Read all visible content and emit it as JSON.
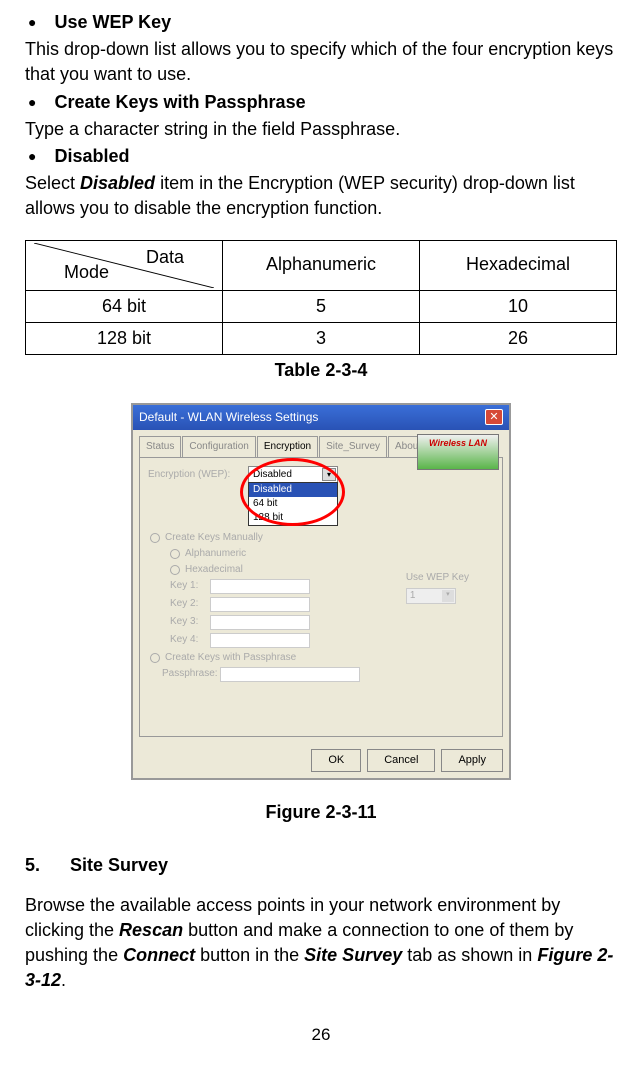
{
  "bullets": [
    {
      "title": "Use WEP Key",
      "body": "This drop-down list allows you to specify which of the four encryption keys that you want to use."
    },
    {
      "title": "Create Keys with Passphrase",
      "body": "Type a character string in the field Passphrase."
    },
    {
      "title": "Disabled",
      "body_prefix": "Select ",
      "body_bold": "Disabled",
      "body_suffix": " item in the Encryption (WEP security) drop-down list allows you to disable the encryption function."
    }
  ],
  "table": {
    "header": {
      "data": "Data",
      "mode": "Mode",
      "col1": "Alphanumeric",
      "col2": "Hexadecimal"
    },
    "rows": [
      {
        "label": "64 bit",
        "c1": "5",
        "c2": "10"
      },
      {
        "label": "128 bit",
        "c1": "3",
        "c2": "26"
      }
    ],
    "caption": "Table 2-3-4"
  },
  "screenshot": {
    "title": "Default - WLAN Wireless Settings",
    "tabs": [
      "Status",
      "Configuration",
      "Encryption",
      "Site_Survey",
      "About"
    ],
    "logo_text": "Wireless LAN",
    "enc_label": "Encryption (WEP):",
    "enc_value": "Disabled",
    "enc_options": [
      "Disabled",
      "64 bit",
      "128 bit"
    ],
    "radio_create_manual": "Create Keys Manually",
    "radio_alpha": "Alphanumeric",
    "radio_hex": "Hexadecimal",
    "keys": [
      "Key 1:",
      "Key 2:",
      "Key 3:",
      "Key 4:"
    ],
    "use_wep_label": "Use WEP Key",
    "use_wep_value": "1",
    "radio_passphrase": "Create Keys with Passphrase",
    "passphrase_label": "Passphrase:",
    "buttons": {
      "ok": "OK",
      "cancel": "Cancel",
      "apply": "Apply"
    }
  },
  "figure_caption": "Figure 2-3-11",
  "section": {
    "num": "5.",
    "title": "Site Survey",
    "body_parts": {
      "p1": "Browse the available access points in your network environment by clicking the ",
      "b1": "Rescan",
      "p2": " button and make a connection to one of them by pushing the ",
      "b2": "Connect",
      "p3": " button in the ",
      "b3": "Site Survey",
      "p4": " tab as shown in ",
      "b4": "Figure 2-3-12",
      "p5": "."
    }
  },
  "page_num": "26"
}
